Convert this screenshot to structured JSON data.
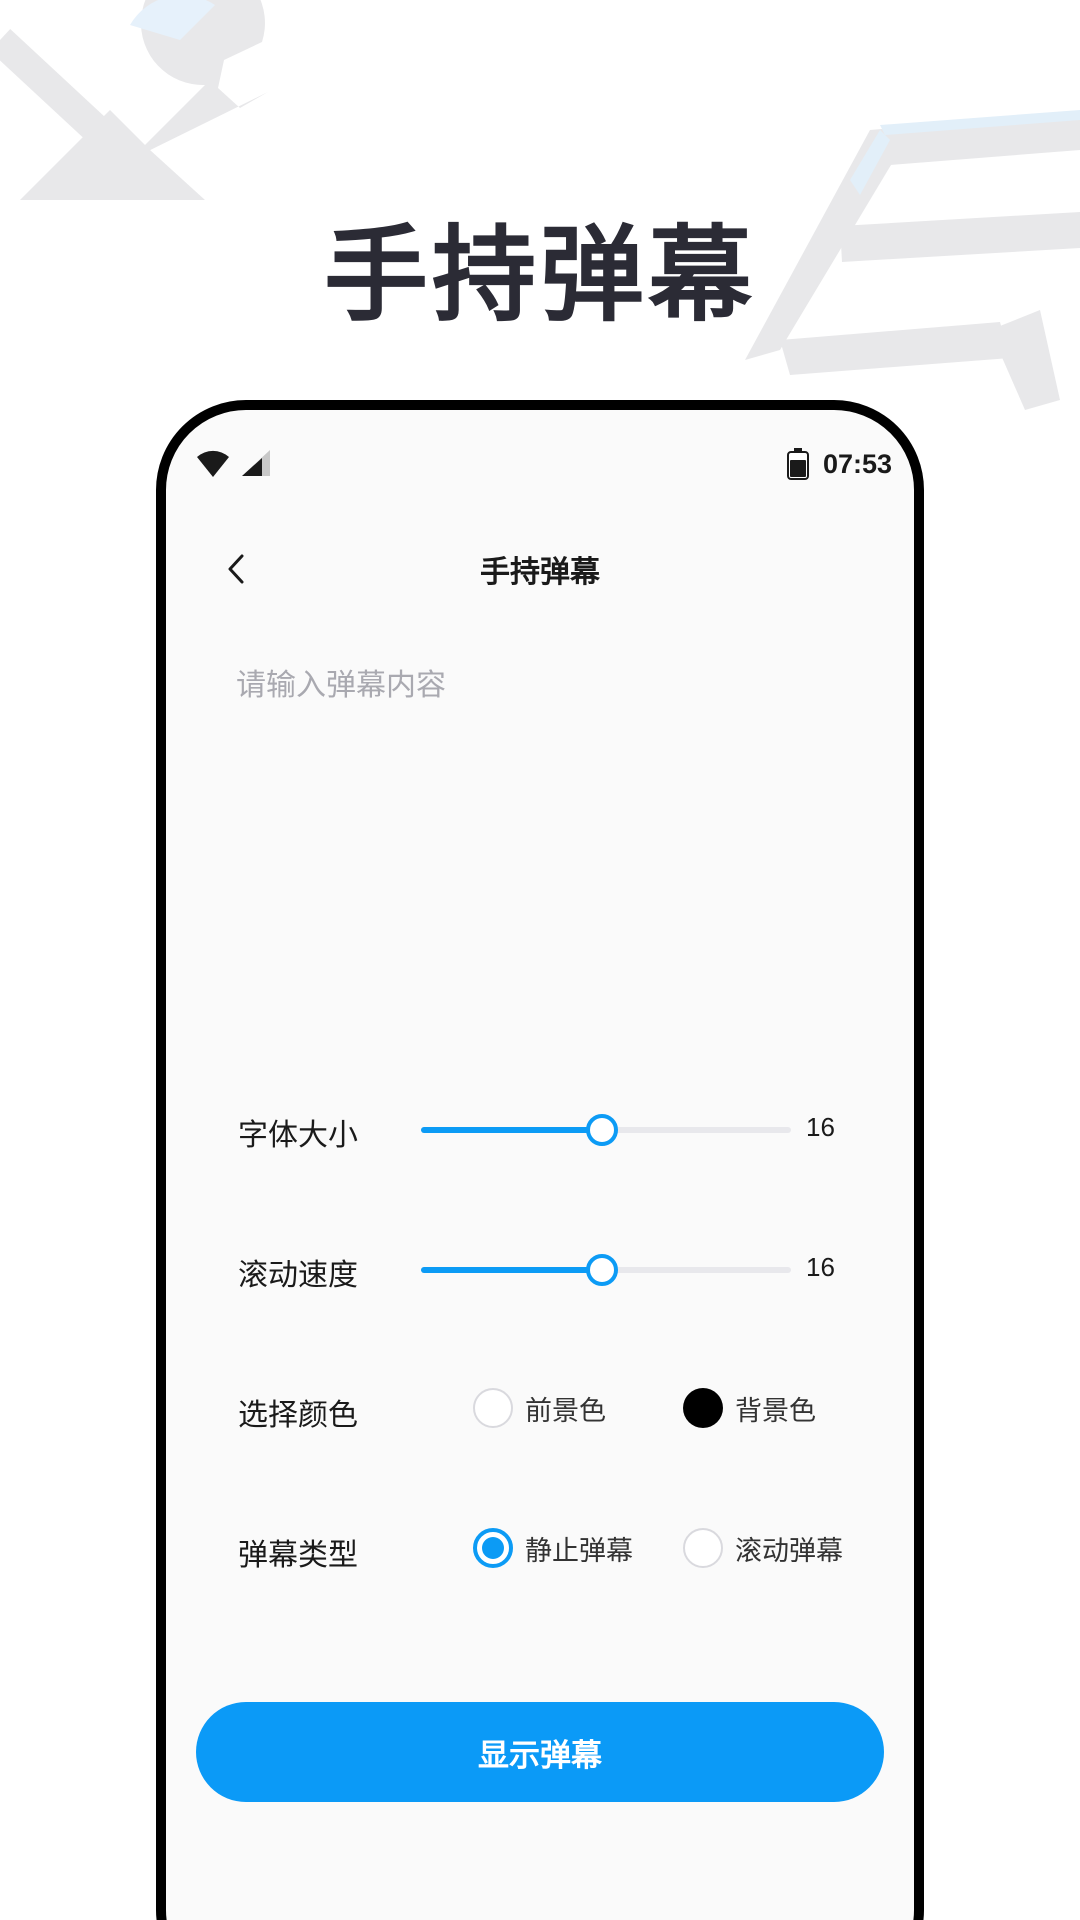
{
  "promo": {
    "title": "手持弹幕"
  },
  "status": {
    "time": "07:53"
  },
  "nav": {
    "title": "手持弹幕"
  },
  "input": {
    "placeholder": "请输入弹幕内容",
    "value": ""
  },
  "settings": {
    "font_size": {
      "label": "字体大小",
      "value": "16",
      "fraction": 0.49
    },
    "scroll_speed": {
      "label": "滚动速度",
      "value": "16",
      "fraction": 0.49
    },
    "color": {
      "label": "选择颜色",
      "options": [
        "前景色",
        "背景色"
      ]
    },
    "type": {
      "label": "弹幕类型",
      "options": [
        "静止弹幕",
        "滚动弹幕"
      ],
      "selected": "静止弹幕"
    }
  },
  "button": {
    "label": "显示弹幕"
  },
  "colors": {
    "accent": "#0c9bf5",
    "button": "#0b9af7",
    "title": "#2b2b35",
    "frame": "#000000"
  },
  "icons": [
    "wrench-icon",
    "chair-icon",
    "wifi-icon",
    "signal-icon",
    "battery-icon",
    "back-arrow-icon"
  ]
}
